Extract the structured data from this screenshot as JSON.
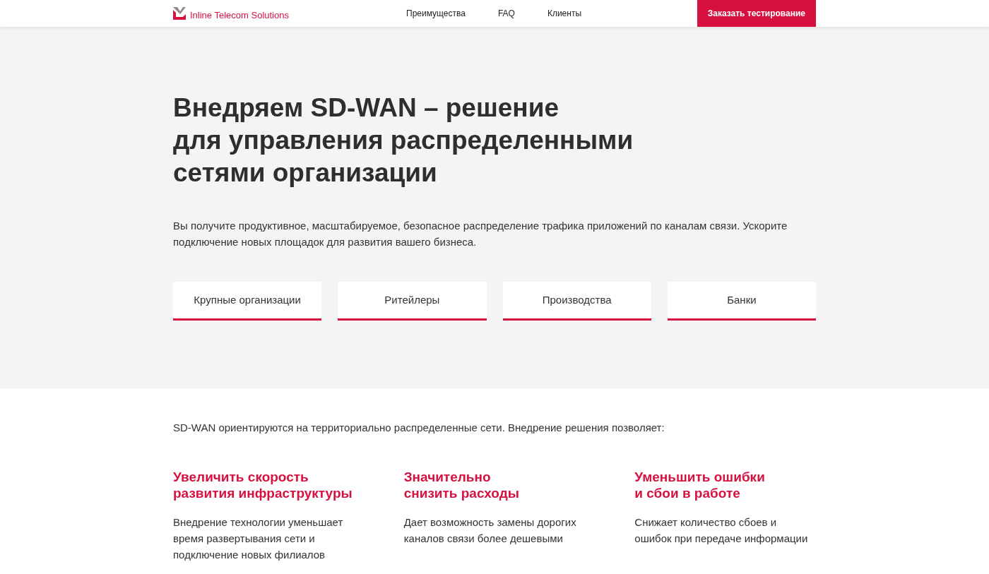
{
  "header": {
    "logo_text": "Inline Telecom Solutions",
    "nav": [
      "Преимущества",
      "FAQ",
      "Клиенты"
    ],
    "cta": "Заказать тестирование"
  },
  "hero": {
    "title_lines": [
      "Внедряем SD-WAN – решение",
      "для управления распределенными",
      "сетями организации"
    ],
    "description": "Вы получите продуктивное, масштабируемое, безопасное распределение трафика приложений по каналам связи. Ускорите подключение новых площадок для развития вашего бизнеса.",
    "segments": [
      "Крупные организации",
      "Ритейлеры",
      "Производства",
      "Банки"
    ]
  },
  "benefits": {
    "intro": "SD-WAN ориентируются на территориально распределенные сети. Внедрение решения позволяет:",
    "items": [
      {
        "title_lines": [
          "Увеличить скорость",
          "развития инфраструктуры"
        ],
        "text": "Внедрение технологии уменьшает время развертывания сети и подключение новых филиалов"
      },
      {
        "title_lines": [
          "Значительно",
          "снизить расходы"
        ],
        "text": "Дает возможность замены дорогих каналов связи более дешевыми"
      },
      {
        "title_lines": [
          "Уменьшить ошибки",
          "и сбои в работе"
        ],
        "text": "Снижает количество сбоев и ошибок при передаче информации"
      }
    ]
  }
}
